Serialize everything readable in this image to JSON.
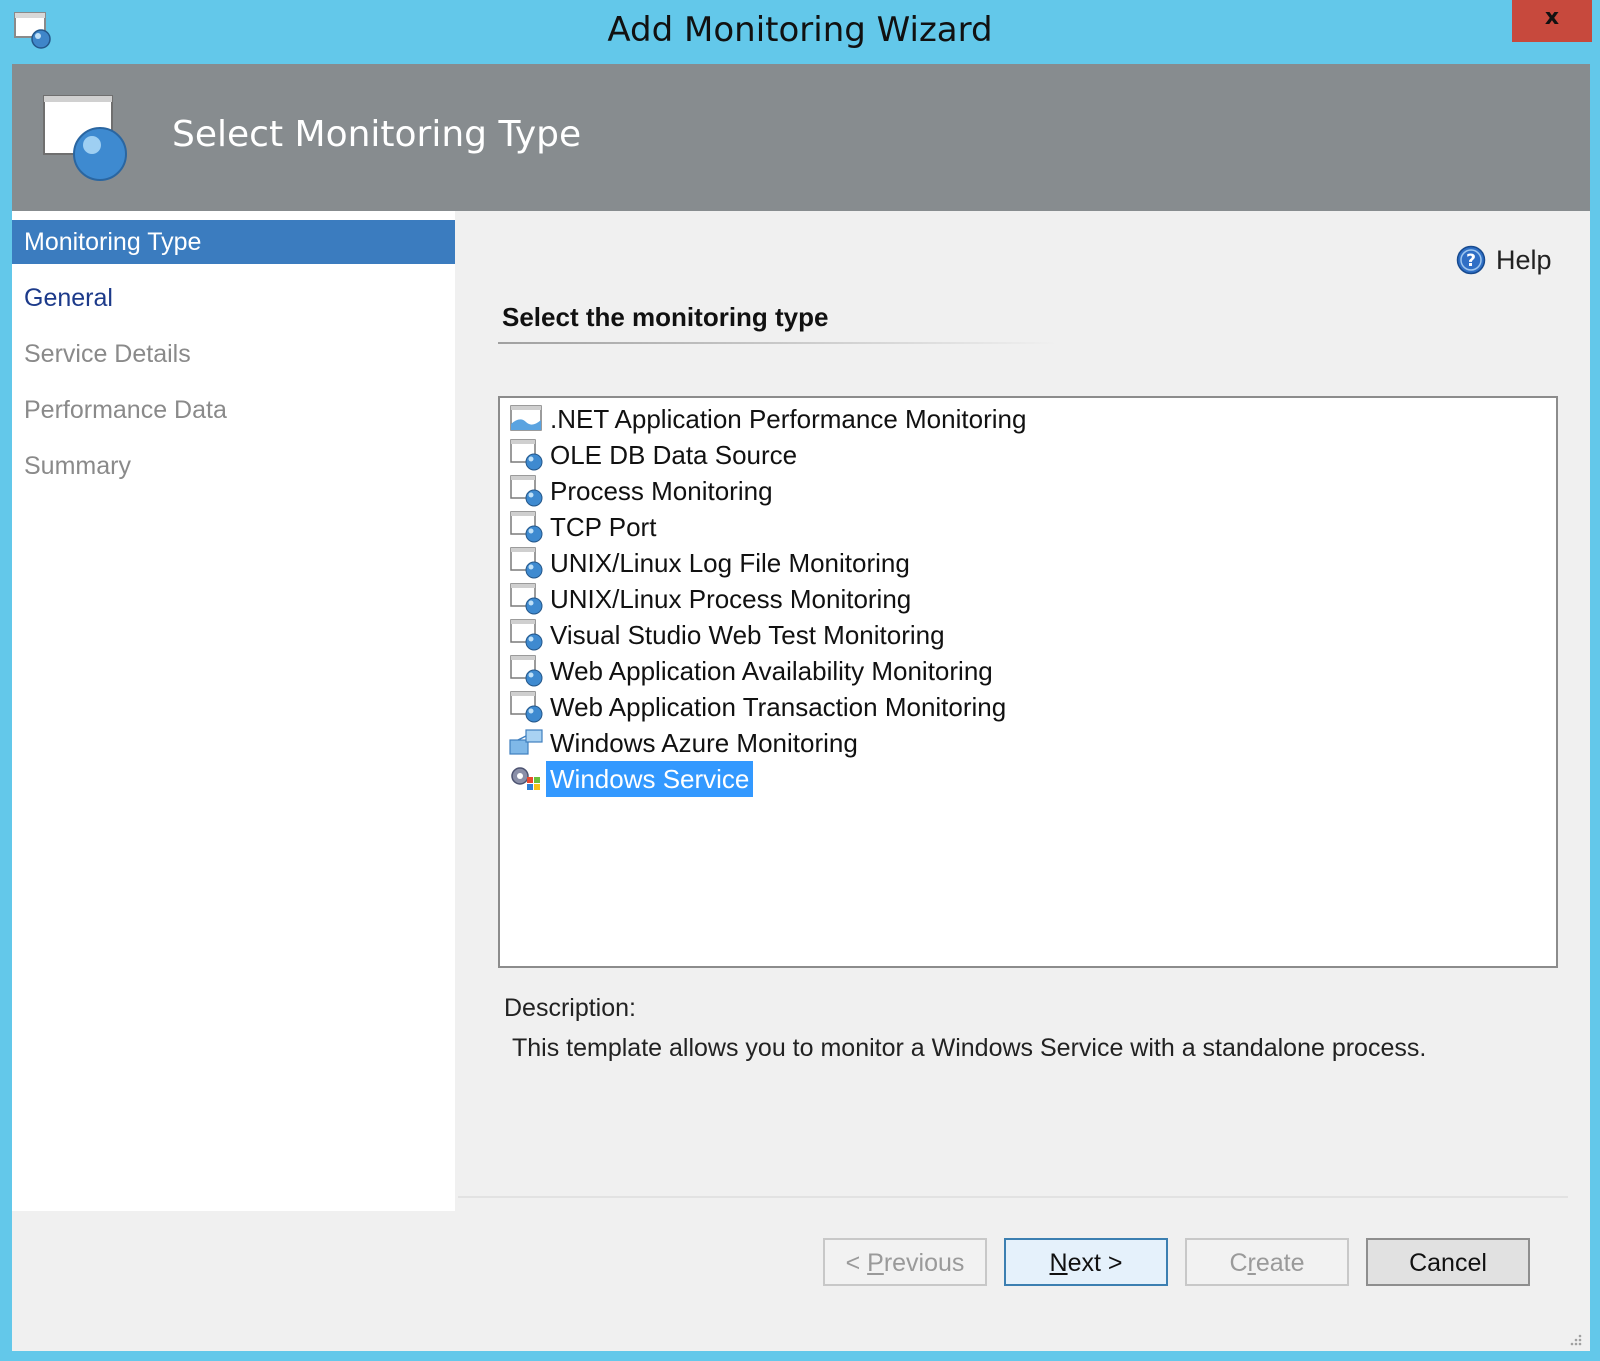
{
  "window": {
    "title": "Add Monitoring Wizard",
    "close_label": "x"
  },
  "header": {
    "title": "Select Monitoring Type"
  },
  "nav": {
    "items": [
      {
        "label": "Monitoring Type",
        "state": "active"
      },
      {
        "label": "General",
        "state": "enabled"
      },
      {
        "label": "Service Details",
        "state": "disabled"
      },
      {
        "label": "Performance Data",
        "state": "disabled"
      },
      {
        "label": "Summary",
        "state": "disabled"
      }
    ]
  },
  "help": {
    "label": "Help",
    "icon": "help-icon"
  },
  "content": {
    "section_title": "Select the monitoring type",
    "types": [
      {
        "label": ".NET Application Performance Monitoring",
        "icon": "dotnet-apm-icon"
      },
      {
        "label": "OLE DB Data Source",
        "icon": "template-icon"
      },
      {
        "label": "Process Monitoring",
        "icon": "template-icon"
      },
      {
        "label": "TCP Port",
        "icon": "template-icon"
      },
      {
        "label": "UNIX/Linux Log File Monitoring",
        "icon": "template-icon"
      },
      {
        "label": "UNIX/Linux Process Monitoring",
        "icon": "template-icon"
      },
      {
        "label": "Visual Studio Web Test Monitoring",
        "icon": "template-icon"
      },
      {
        "label": "Web Application Availability Monitoring",
        "icon": "template-icon"
      },
      {
        "label": "Web Application Transaction Monitoring",
        "icon": "template-icon"
      },
      {
        "label": "Windows Azure Monitoring",
        "icon": "azure-icon"
      },
      {
        "label": "Windows Service",
        "icon": "windows-service-icon",
        "selected": true
      }
    ],
    "description_label": "Description:",
    "description_text": "This template allows you to monitor a Windows Service with a standalone process."
  },
  "buttons": {
    "previous_prefix": "< ",
    "previous_accel": "P",
    "previous_rest": "revious",
    "next_accel": "N",
    "next_rest": "ext >",
    "create_prefix": "C",
    "create_accel": "r",
    "create_rest": "eate",
    "cancel": "Cancel"
  },
  "colors": {
    "titlebar": "#63c8ea",
    "header": "#878c8f",
    "nav_active": "#3b7cbf",
    "selection": "#3399ff",
    "close": "#c7493d"
  }
}
